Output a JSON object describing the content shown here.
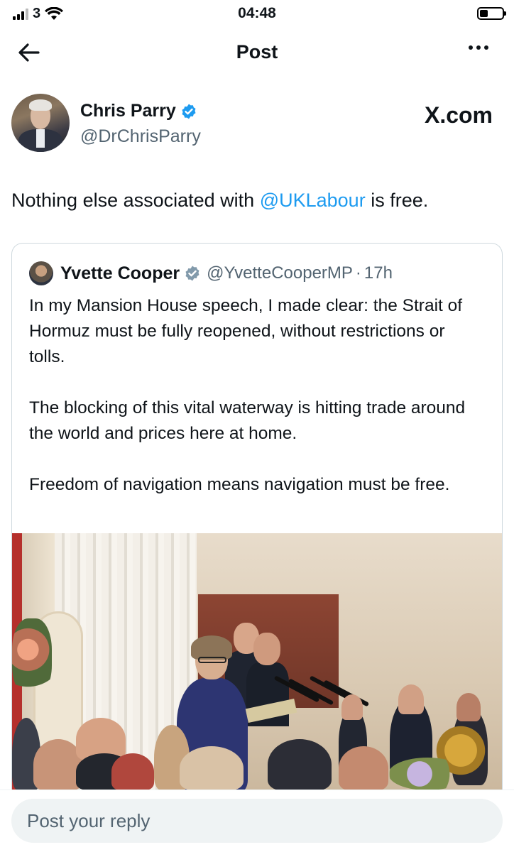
{
  "status_bar": {
    "carrier": "3",
    "time": "04:48",
    "battery_level": 0.35,
    "signal_bars": 3
  },
  "header": {
    "title": "Post",
    "back_icon": "arrow-left-icon",
    "more_icon": "more-horizontal-icon"
  },
  "post": {
    "author_name": "Chris Parry",
    "author_handle": "@DrChrisParry",
    "watermark": "X.com",
    "text_before": "Nothing else associated with ",
    "mention": "@UKLabour",
    "text_after": " is free."
  },
  "quote": {
    "author_name": "Yvette Cooper",
    "author_handle": "@YvetteCooperMP",
    "separator": "·",
    "time_ago": "17h",
    "paragraphs": [
      "In my Mansion House speech, I made clear: the Strait of Hormuz must be fully reopened, without restrictions or tolls.",
      "The blocking of this vital waterway is hitting trade around the world and prices here at home.",
      "Freedom of navigation means navigation must be free."
    ]
  },
  "reply": {
    "placeholder": "Post your reply"
  },
  "colors": {
    "accent": "#1d9bf0",
    "text": "#0f1419",
    "secondary": "#536471",
    "border": "#cfd9de"
  }
}
